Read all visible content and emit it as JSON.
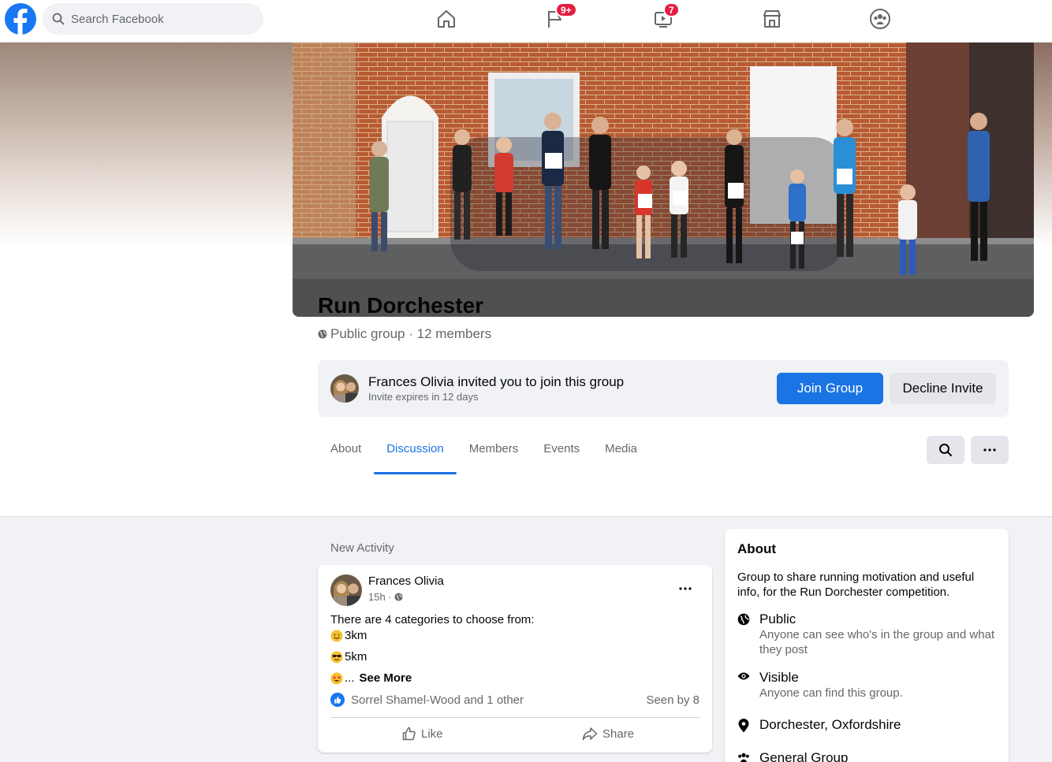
{
  "topbar": {
    "search_placeholder": "Search Facebook",
    "nav": [
      {
        "name": "home",
        "badge": ""
      },
      {
        "name": "pages",
        "badge": "9+"
      },
      {
        "name": "watch",
        "badge": "7"
      },
      {
        "name": "marketplace",
        "badge": ""
      },
      {
        "name": "groups",
        "badge": ""
      }
    ]
  },
  "group": {
    "title": "Run Dorchester",
    "meta": "Public group · 12 members"
  },
  "invite": {
    "title": "Frances Olivia invited you to join this group",
    "subtitle": "Invite expires in 12 days",
    "join_label": "Join Group",
    "decline_label": "Decline Invite"
  },
  "tabs": [
    {
      "label": "About",
      "active": false
    },
    {
      "label": "Discussion",
      "active": true
    },
    {
      "label": "Members",
      "active": false
    },
    {
      "label": "Events",
      "active": false
    },
    {
      "label": "Media",
      "active": false
    }
  ],
  "feed": {
    "section_label": "New Activity",
    "post": {
      "author": "Frances Olivia",
      "time": "15h ·",
      "intro": "There are 4 categories to choose from:",
      "items": [
        "3km",
        "5km"
      ],
      "truncated": "...",
      "see_more": "See More",
      "reactions": "Sorrel Shamel-Wood and 1 other",
      "seen": "Seen by 8",
      "like_label": "Like",
      "share_label": "Share"
    }
  },
  "about": {
    "title": "About",
    "description": "Group to share running motivation and useful info, for the Run Dorchester competition.",
    "privacy_title": "Public",
    "privacy_desc": "Anyone can see who's in the group and what they post",
    "visibility_title": "Visible",
    "visibility_desc": "Anyone can find this group.",
    "location": "Dorchester, Oxfordshire",
    "type": "General Group"
  },
  "colors": {
    "brand": "#1877f2",
    "primary_button": "#1b74e4",
    "badge": "#e41e3f"
  }
}
